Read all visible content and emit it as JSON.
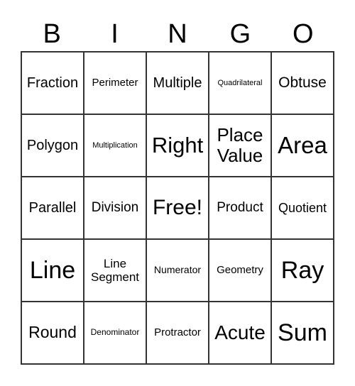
{
  "header": [
    "B",
    "I",
    "N",
    "G",
    "O"
  ],
  "cells": [
    {
      "text": "Fraction",
      "size": 20
    },
    {
      "text": "Perimeter",
      "size": 15
    },
    {
      "text": "Multiple",
      "size": 20
    },
    {
      "text": "Quadrilateral",
      "size": 11
    },
    {
      "text": "Obtuse",
      "size": 21
    },
    {
      "text": "Polygon",
      "size": 20
    },
    {
      "text": "Multiplication",
      "size": 11
    },
    {
      "text": "Right",
      "size": 31
    },
    {
      "text": "Place Value",
      "size": 26
    },
    {
      "text": "Area",
      "size": 33
    },
    {
      "text": "Parallel",
      "size": 20
    },
    {
      "text": "Division",
      "size": 19
    },
    {
      "text": "Free!",
      "size": 30
    },
    {
      "text": "Product",
      "size": 19
    },
    {
      "text": "Quotient",
      "size": 18
    },
    {
      "text": "Line",
      "size": 34
    },
    {
      "text": "Line Segment",
      "size": 17
    },
    {
      "text": "Numerator",
      "size": 14
    },
    {
      "text": "Geometry",
      "size": 15
    },
    {
      "text": "Ray",
      "size": 34
    },
    {
      "text": "Round",
      "size": 23
    },
    {
      "text": "Denominator",
      "size": 12
    },
    {
      "text": "Protractor",
      "size": 15
    },
    {
      "text": "Acute",
      "size": 28
    },
    {
      "text": "Sum",
      "size": 34
    }
  ]
}
